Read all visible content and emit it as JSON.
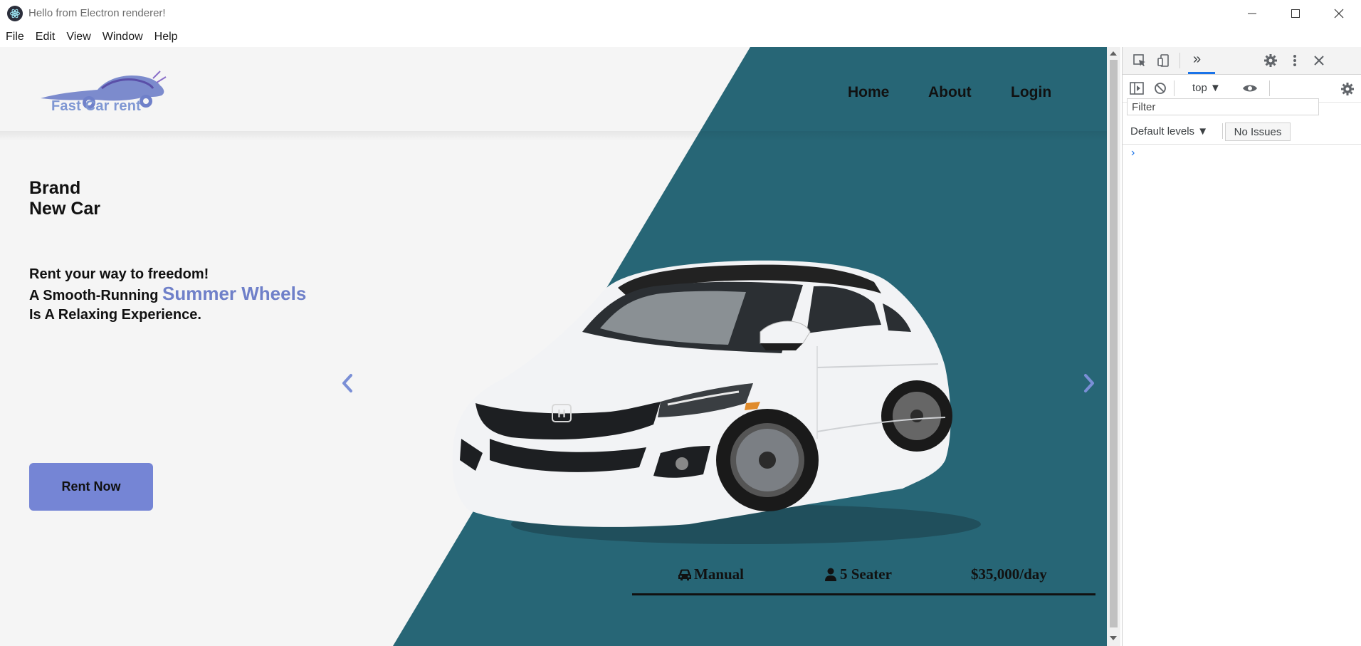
{
  "window": {
    "title": "Hello from Electron renderer!",
    "controls": [
      "minimize",
      "maximize",
      "close"
    ]
  },
  "menu": [
    "File",
    "Edit",
    "View",
    "Window",
    "Help"
  ],
  "site": {
    "logo_text": "Fast Car rent",
    "nav": [
      "Home",
      "About",
      "Login"
    ],
    "hero_title_line1": "Brand",
    "hero_title_line2": "New Car",
    "tagline_line1": "Rent your way to freedom!",
    "tagline_line2_prefix": "A Smooth-Running ",
    "tagline_line2_accent": "Summer Wheels",
    "tagline_line3": "Is A Relaxing Experience.",
    "cta_label": "Rent Now",
    "specs": {
      "transmission": "Manual",
      "seats": "5 Seater",
      "price": "$35,000/day"
    },
    "colors": {
      "background": "#f5f5f5",
      "teal": "#276676",
      "accent": "#7585d5",
      "arrow": "#7a8fd6"
    }
  },
  "devtools": {
    "tabs_overflow": "»",
    "context": "top",
    "filter_placeholder": "Filter",
    "levels_label": "Default levels ▼",
    "issues_label": "No Issues",
    "prompt": "›"
  }
}
